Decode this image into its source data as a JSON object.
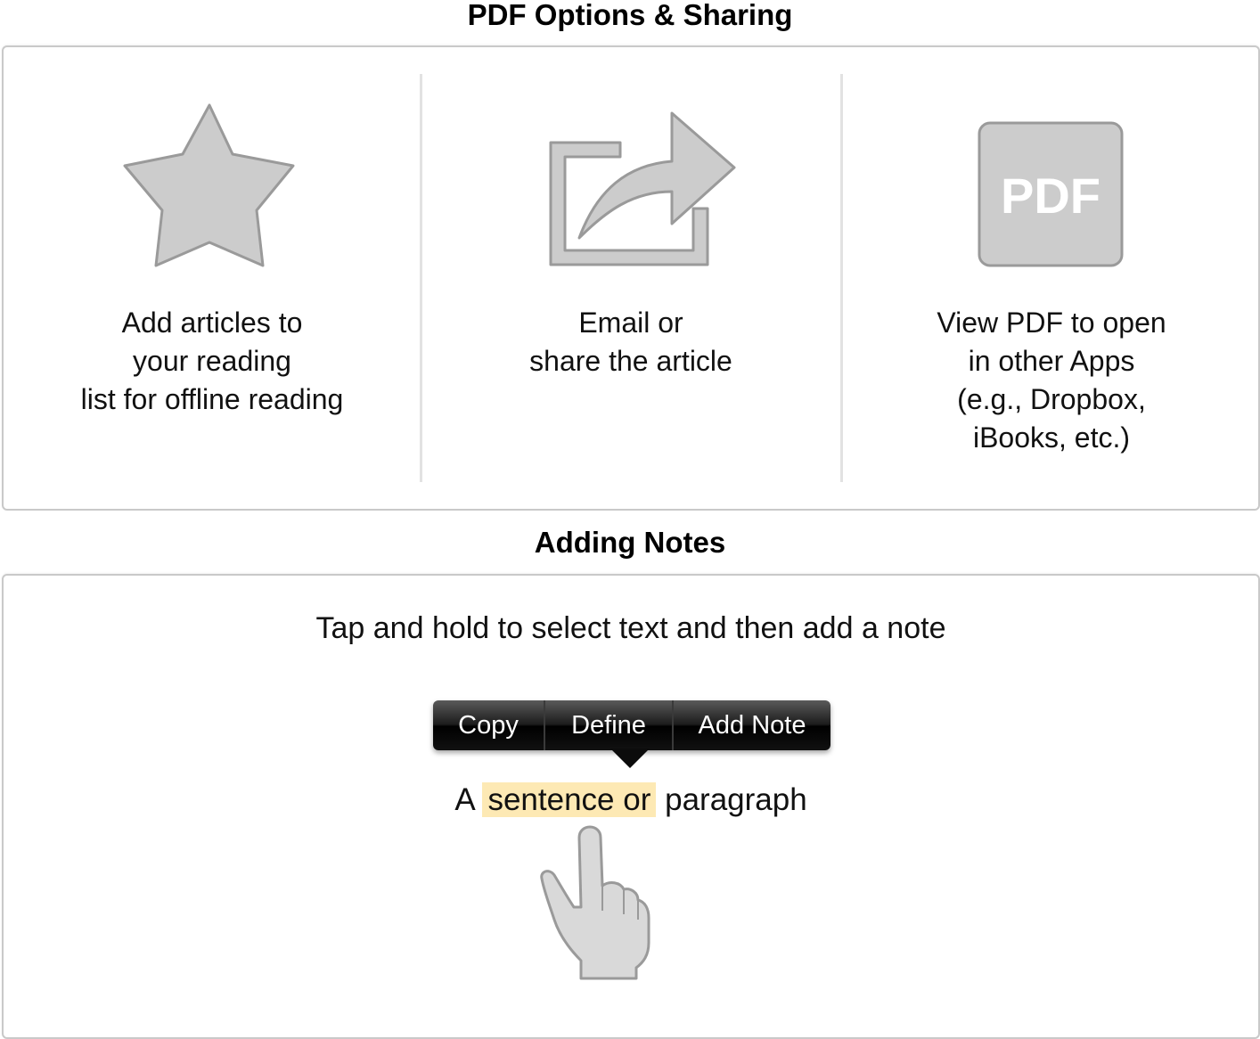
{
  "sections": {
    "pdf_options": {
      "title": "PDF Options & Sharing",
      "columns": [
        {
          "icon": "star-icon",
          "lines": [
            "Add articles to",
            "your reading",
            "list for offline reading"
          ]
        },
        {
          "icon": "share-icon",
          "lines": [
            "Email or",
            "share the article"
          ]
        },
        {
          "icon": "pdf-icon",
          "icon_text": "PDF",
          "lines": [
            "View PDF to open",
            "in other Apps",
            "(e.g., Dropbox,",
            "iBooks, etc.)"
          ]
        }
      ]
    },
    "adding_notes": {
      "title": "Adding Notes",
      "instruction": "Tap and hold to select text and then add a note",
      "menu": {
        "copy": "Copy",
        "define": "Define",
        "add_note": "Add Note"
      },
      "sentence": {
        "before": "A",
        "highlighted": "sentence or",
        "after": "paragraph"
      },
      "gesture_icon": "pointing-hand-icon"
    }
  },
  "colors": {
    "icon_fill": "#cccccc",
    "icon_stroke": "#9a9a9a",
    "highlight": "#fde9b4",
    "panel_border": "#c9c9c9"
  }
}
